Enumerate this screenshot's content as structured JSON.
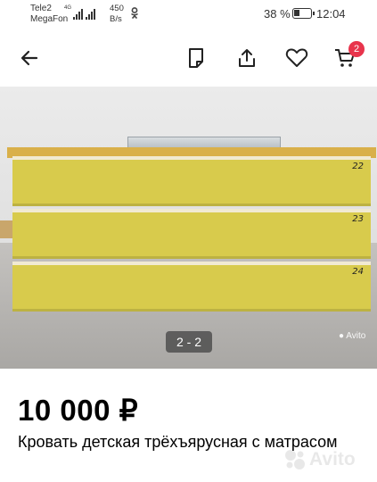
{
  "status_bar": {
    "carrier_1": "Tele2",
    "carrier_2": "MegaFon",
    "network_type": "4G",
    "speed_value": "450",
    "speed_unit": "B/s",
    "battery_percent": "38 %",
    "battery_level": 0.38,
    "time": "12:04",
    "icons": [
      "signal-icon",
      "signal-icon",
      "ok-notification-icon",
      "battery-icon"
    ]
  },
  "header": {
    "back_icon": "arrow-left-icon",
    "actions": [
      "note-icon",
      "share-icon",
      "heart-icon",
      "cart-icon"
    ],
    "cart_count": "2"
  },
  "gallery": {
    "counter": "2 - 2",
    "watermark": "Avito",
    "drawer_labels": [
      "22",
      "23",
      "24"
    ],
    "colors": {
      "drawer": "#d8cb4c",
      "floor": "#b2b0ad",
      "wall": "#e6e6e6"
    }
  },
  "listing": {
    "price": "10 000 ₽",
    "title": "Кровать детская трёхъярусная с матрасом"
  },
  "watermark": "Avito",
  "colors": {
    "accent": "#e8344c",
    "icon": "#333333"
  }
}
